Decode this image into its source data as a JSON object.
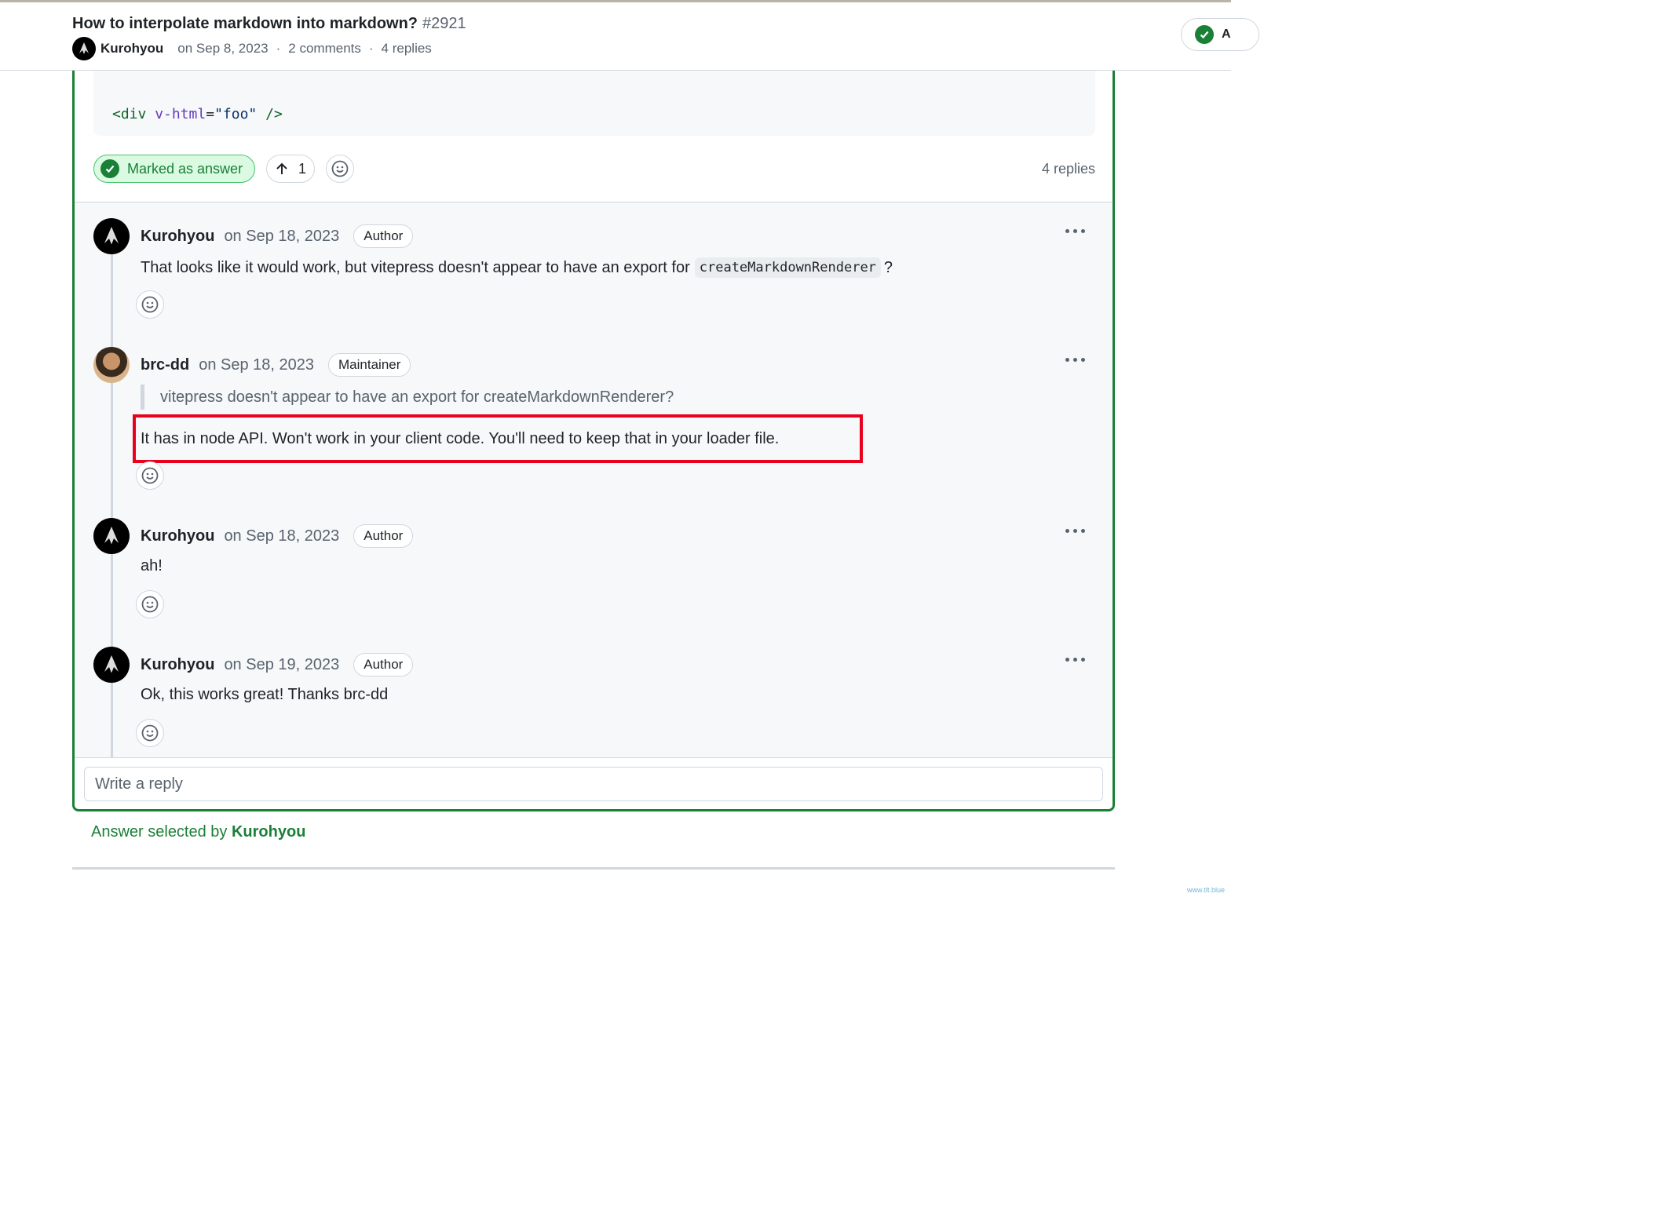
{
  "header": {
    "title": "How to interpolate markdown into markdown?",
    "number": "#2921",
    "author": "Kurohyou",
    "date": "on Sep 8, 2023",
    "comments": "2 comments",
    "replies": "4 replies",
    "answered_label": "A"
  },
  "answer": {
    "code": {
      "tag_open": "<div",
      "attr": "v-html",
      "eq": "=",
      "value": "\"foo\"",
      "tag_close": " />"
    },
    "marked_label": "Marked as answer",
    "upvote_count": "1",
    "reply_count": "4 replies"
  },
  "replies": [
    {
      "author": "Kurohyou",
      "date": "on Sep 18, 2023",
      "badge": "Author",
      "body": "That looks like it would work, but vitepress doesn't appear to have an export for",
      "code": "createMarkdownRenderer",
      "body_after": "?"
    },
    {
      "author": "brc-dd",
      "date": "on Sep 18, 2023",
      "badge": "Maintainer",
      "quote": "vitepress doesn't appear to have an export for createMarkdownRenderer?",
      "body": "It has in node API. Won't work in your client code. You'll need to keep that in your loader file."
    },
    {
      "author": "Kurohyou",
      "date": "on Sep 18, 2023",
      "badge": "Author",
      "body": "ah!"
    },
    {
      "author": "Kurohyou",
      "date": "on Sep 19, 2023",
      "badge": "Author",
      "body": "Ok, this works great! Thanks brc-dd"
    }
  ],
  "reply_input": {
    "placeholder": "Write a reply"
  },
  "footer": {
    "answer_selected_prefix": "Answer selected by",
    "answer_selected_by": "Kurohyou"
  },
  "watermark": "www.tlt.blue",
  "colors": {
    "accent_green": "#1a7f37",
    "highlight_red": "#e8001c",
    "muted": "#59636e",
    "border": "#d0d7de"
  }
}
